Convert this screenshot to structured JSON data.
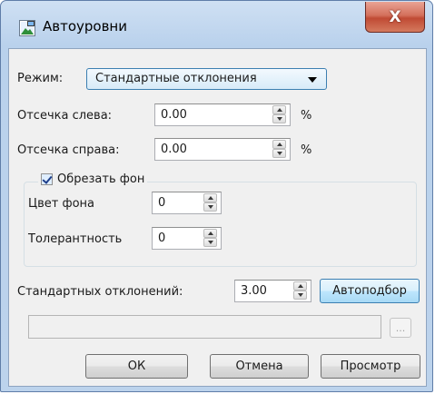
{
  "window": {
    "title": "Автоуровни",
    "close_glyph": "X"
  },
  "mode": {
    "label": "Режим:",
    "selected": "Стандартные отклонения"
  },
  "clip_left": {
    "label": "Отсечка слева:",
    "value": "0.00",
    "unit": "%"
  },
  "clip_right": {
    "label": "Отсечка справа:",
    "value": "0.00",
    "unit": "%"
  },
  "crop_background": {
    "label": "Обрезать фон",
    "checked": true,
    "color": {
      "label": "Цвет фона",
      "value": "0"
    },
    "tolerance": {
      "label": "Толерантность",
      "value": "0"
    }
  },
  "std_dev": {
    "label": "Стандартных отклонений:",
    "value": "3.00"
  },
  "buttons": {
    "auto_fit": "Автоподбор",
    "browse": "...",
    "ok": "ОК",
    "cancel": "Отмена",
    "preview": "Просмотр"
  },
  "icons": {
    "app": "app-icon",
    "close": "close-icon",
    "dropdown": "chevron-down-icon"
  }
}
